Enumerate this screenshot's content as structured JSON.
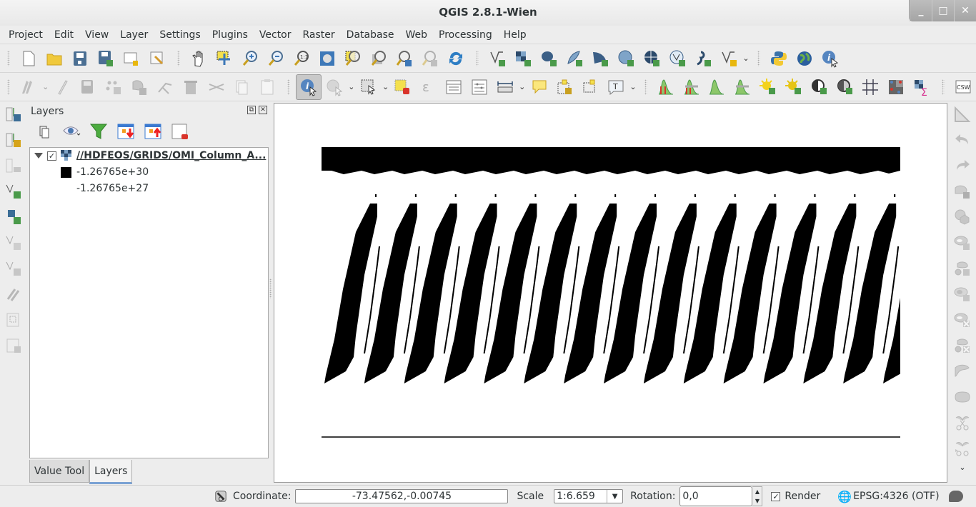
{
  "window": {
    "title": "QGIS 2.8.1-Wien",
    "controls": [
      "minimize",
      "maximize",
      "close"
    ]
  },
  "menu": [
    "Project",
    "Edit",
    "View",
    "Layer",
    "Settings",
    "Plugins",
    "Vector",
    "Raster",
    "Database",
    "Web",
    "Processing",
    "Help"
  ],
  "toolbar1": {
    "file": [
      "new-project",
      "open-project",
      "save-project",
      "save-project-as",
      "new-print-composer",
      "composer-manager"
    ],
    "navigation": [
      "pan",
      "pan-to-selection",
      "zoom-in",
      "zoom-out",
      "zoom-native",
      "zoom-full",
      "zoom-to-selection",
      "zoom-to-layer",
      "zoom-last",
      "zoom-next",
      "refresh"
    ],
    "add_layers": [
      "add-vector-layer",
      "add-raster-layer",
      "add-postgis-layer",
      "add-spatialite-layer",
      "add-mssql-layer",
      "add-wms-layer",
      "add-wcs-layer",
      "add-wfs-layer",
      "add-delimited-text-layer",
      "new-shapefile-layer"
    ],
    "plugins": [
      "python-console",
      "globe",
      "identify-plugin"
    ]
  },
  "toolbar2": {
    "digitizing": [
      "current-edits",
      "toggle-editing",
      "save-edits",
      "add-feature",
      "move-feature",
      "node-tool",
      "delete-selected",
      "cut-features",
      "copy-features",
      "paste-features"
    ],
    "attributes": [
      "identify-features",
      "run-feature-action",
      "select-features",
      "deselect-all",
      "select-by-expression",
      "open-attribute-table",
      "field-calculator",
      "measure-line",
      "map-tips",
      "new-bookmark",
      "show-bookmarks",
      "text-annotation"
    ],
    "raster": [
      "local-histogram-stretch",
      "full-histogram-stretch",
      "local-cumulative-cut",
      "full-cumulative-cut",
      "increase-brightness",
      "decrease-brightness",
      "increase-contrast",
      "decrease-contrast",
      "georeferencer",
      "heatmap",
      "zonal-statistics",
      "metasearch-csw"
    ],
    "active_tool": "identify-features"
  },
  "left_toolbar": [
    "add-raster-upload",
    "add-raster-new",
    "remove-raster",
    "add-vector-grass",
    "add-raster-grass",
    "new-vector-grass",
    "edit-vector-grass",
    "grass-tools",
    "grass-region",
    "edit-region"
  ],
  "right_toolbar": [
    "measure-angle",
    "undo",
    "redo",
    "rotate-feature",
    "simplify-feature",
    "add-ring",
    "add-part",
    "fill-ring",
    "delete-ring",
    "delete-part",
    "reshape-features",
    "offset-curve",
    "split-features",
    "split-parts"
  ],
  "layers_panel": {
    "title": "Layers",
    "tools": [
      "add-group",
      "manage-visibility",
      "filter-legend",
      "expand-all",
      "collapse-all",
      "remove-layer"
    ],
    "layer": {
      "name": "//HDFEOS/GRIDS/OMI_Column_A...",
      "checked": true,
      "expanded": true
    },
    "legend": [
      {
        "label": "-1.26765e+30",
        "color": "#000000"
      },
      {
        "label": "-1.26765e+27",
        "color": "#ffffff"
      }
    ],
    "tabs": [
      {
        "label": "Value Tool",
        "active": false
      },
      {
        "label": "Layers",
        "active": true
      }
    ]
  },
  "statusbar": {
    "coordinate_label": "Coordinate:",
    "coordinate_value": "-73.47562,-0.00745",
    "scale_label": "Scale",
    "scale_value": "1:6.659",
    "rotation_label": "Rotation:",
    "rotation_value": "0,0",
    "render_label": "Render",
    "render_checked": true,
    "crs": "EPSG:4326 (OTF)"
  },
  "map": {
    "stripe_count": 15,
    "foreground": "#000000",
    "background": "#ffffff"
  }
}
